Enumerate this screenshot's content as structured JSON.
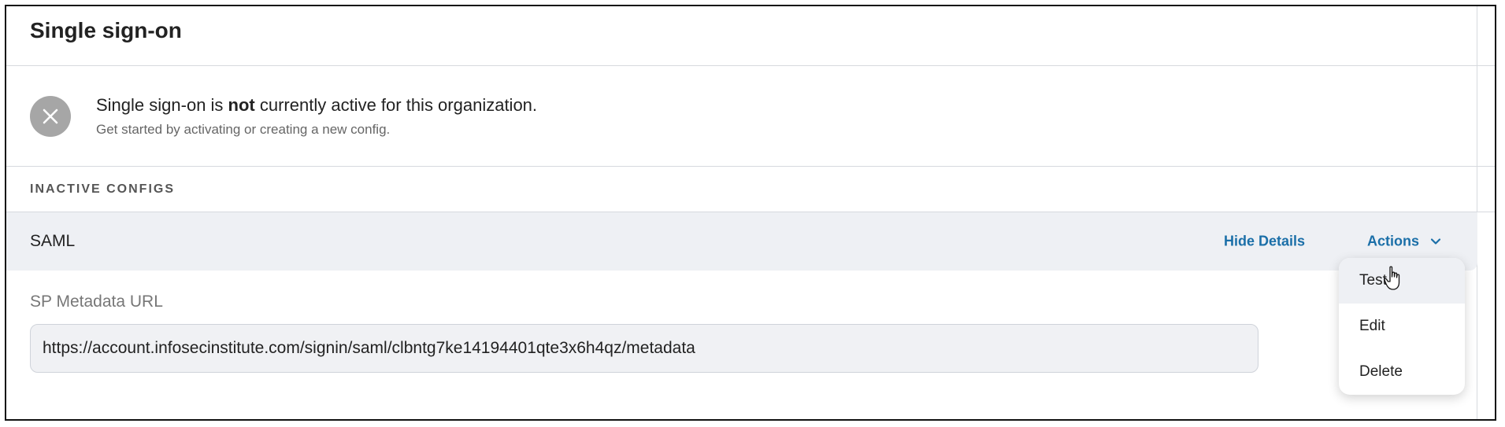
{
  "header": {
    "title": "Single sign-on"
  },
  "notice": {
    "icon": "close-icon",
    "text_before": "Single sign-on is ",
    "text_bold": "not",
    "text_after": " currently active for this organization.",
    "subtext": "Get started by activating or creating a new config."
  },
  "inactive_configs": {
    "label": "INACTIVE CONFIGS",
    "config": {
      "name": "SAML",
      "hide_details_label": "Hide Details",
      "actions_label": "Actions"
    },
    "details": {
      "sp_metadata_label": "SP Metadata URL",
      "sp_metadata_url": "https://account.infosecinstitute.com/signin/saml/clbntg7ke14194401qte3x6h4qz/metadata"
    }
  },
  "actions_menu": {
    "items": [
      {
        "label": "Test"
      },
      {
        "label": "Edit"
      },
      {
        "label": "Delete"
      }
    ]
  },
  "colors": {
    "link": "#1b6fa8",
    "row_bg": "#eef0f4",
    "icon_bg": "#a6a6a6"
  }
}
